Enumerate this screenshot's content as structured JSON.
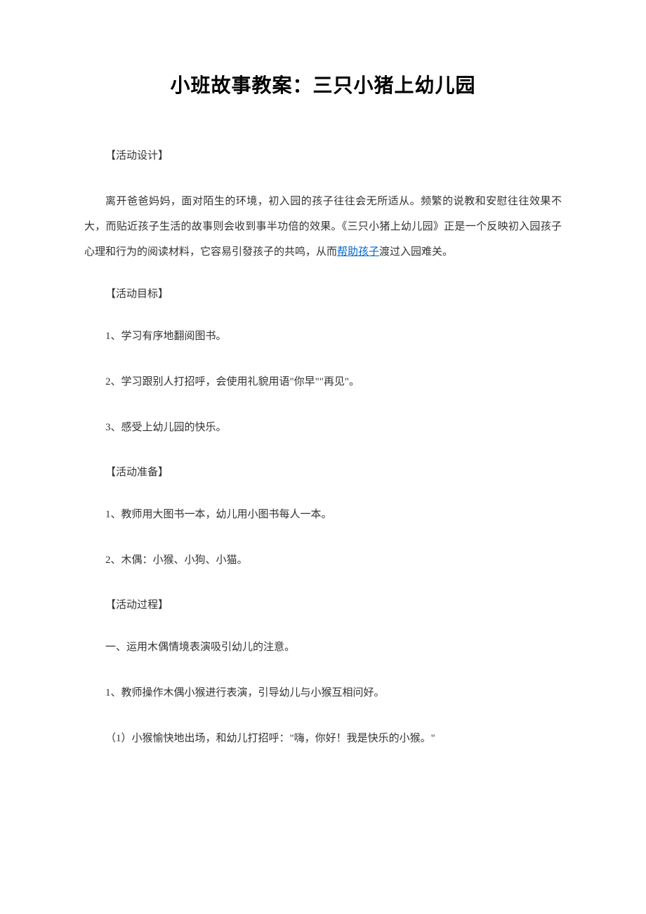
{
  "title": "小班故事教案：三只小猪上幼儿园",
  "sections": {
    "design": {
      "header": "【活动设计】",
      "paragraph_part1": "离开爸爸妈妈，面对陌生的环境，初入园的孩子往往会无所适从。频繁的说教和安慰往往效果不大，而贴近孩子生活的故事则会收到事半功倍的效果。《三只小猪上幼儿园》正是一个反映初入园孩子心理和行为的阅读材料，它容易引發孩子的共鸣，从而",
      "link_text": "帮助孩子",
      "paragraph_part2": "渡过入园难关。"
    },
    "goals": {
      "header": "【活动目标】",
      "items": [
        "1、学习有序地翻阅图书。",
        "2、学习跟别人打招呼，会使用礼貌用语\"你早\"\"再见\"。",
        "3、感受上幼儿园的快乐。"
      ]
    },
    "preparation": {
      "header": "【活动准备】",
      "items": [
        "1、教师用大图书一本，幼儿用小图书每人一本。",
        "2、木偶：小猴、小狗、小猫。"
      ]
    },
    "process": {
      "header": "【活动过程】",
      "items": [
        "一、运用木偶情境表演吸引幼儿的注意。",
        "1、教师操作木偶小猴进行表演，引导幼儿与小猴互相问好。",
        "（1）小猴愉快地出场，和幼儿打招呼：\"嗨，你好！我是快乐的小猴。\""
      ]
    }
  }
}
